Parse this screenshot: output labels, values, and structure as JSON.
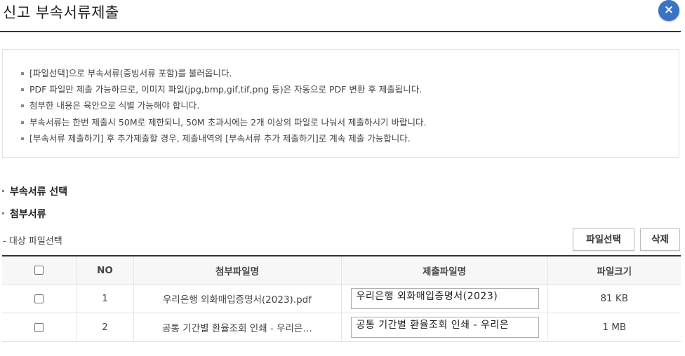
{
  "dialog": {
    "title": "신고 부속서류제출",
    "close_icon": "×"
  },
  "notices": [
    "[파일선택]으로 부속서류(증빙서류 포함)를 불러옵니다.",
    "PDF 파일만 제출 가능하므로, 이미지 파일(jpg,bmp,gif,tif,png 등)은 자동으로 PDF 변환 후 제출됩니다.",
    "첨부한 내용은 육안으로 식별 가능해야 합니다.",
    "부속서류는 한번 제출시 50M로 제한되니, 50M 초과시에는 2개 이상의 파일로 나눠서 제출하시기 바랍니다.",
    "[부속서류 제출하기] 후 추가제출할 경우, 제출내역의 [부속서류 추가 제출하기]로 계속 제출 가능합니다."
  ],
  "sections": {
    "select_title": "부속서류 선택",
    "attach_title": "첨부서류",
    "target_label": "- 대상 파일선택"
  },
  "buttons": {
    "select_file": "파일선택",
    "delete": "삭제"
  },
  "table": {
    "headers": {
      "no": "NO",
      "attach_name": "첨부파일명",
      "submit_name": "제출파일명",
      "size": "파일크기"
    },
    "rows": [
      {
        "no": "1",
        "attach_name": "우리은행 외화매입증명서(2023).pdf",
        "submit_name": "우리은행 외화매입증명서(2023)",
        "size": "81 KB"
      },
      {
        "no": "2",
        "attach_name": "공통 기간별 환율조회 인쇄 - 우리은…",
        "submit_name": "공통 기간별 환율조회 인쇄 - 우리은",
        "size": "1 MB"
      }
    ]
  }
}
